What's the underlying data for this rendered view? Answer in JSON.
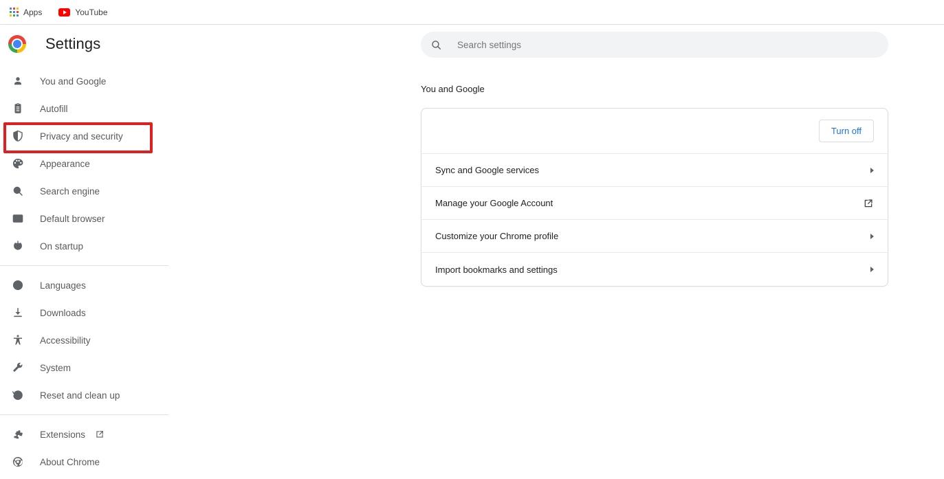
{
  "bookmarks_bar": {
    "items": [
      {
        "label": "Apps",
        "icon": "apps-grid-icon"
      },
      {
        "label": "YouTube",
        "icon": "youtube-icon"
      }
    ]
  },
  "sidebar": {
    "brand": {
      "logo_icon": "chrome-logo-icon",
      "title": "Settings"
    },
    "groups": [
      {
        "items": [
          {
            "label": "You and Google",
            "icon": "person-icon",
            "selected": false
          },
          {
            "label": "Autofill",
            "icon": "clipboard-icon",
            "selected": false
          },
          {
            "label": "Privacy and security",
            "icon": "shield-icon",
            "selected": true
          },
          {
            "label": "Appearance",
            "icon": "palette-icon",
            "selected": false
          },
          {
            "label": "Search engine",
            "icon": "magnifier-icon",
            "selected": false
          },
          {
            "label": "Default browser",
            "icon": "browser-window-icon",
            "selected": false
          },
          {
            "label": "On startup",
            "icon": "power-icon",
            "selected": false
          }
        ]
      },
      {
        "items": [
          {
            "label": "Languages",
            "icon": "globe-icon",
            "selected": false
          },
          {
            "label": "Downloads",
            "icon": "download-icon",
            "selected": false
          },
          {
            "label": "Accessibility",
            "icon": "accessibility-icon",
            "selected": false
          },
          {
            "label": "System",
            "icon": "wrench-icon",
            "selected": false
          },
          {
            "label": "Reset and clean up",
            "icon": "history-restore-icon",
            "selected": false
          }
        ]
      },
      {
        "items": [
          {
            "label": "Extensions",
            "icon": "puzzle-piece-icon",
            "selected": false,
            "trailing_icon": "external-link-icon"
          },
          {
            "label": "About Chrome",
            "icon": "chrome-outline-icon",
            "selected": false
          }
        ]
      }
    ],
    "highlight_color": "#e02020",
    "highlighted_item": "Privacy and security"
  },
  "main": {
    "search": {
      "placeholder": "Search settings",
      "value": "",
      "icon": "search-icon"
    },
    "section_heading": "You and Google",
    "card": {
      "profile_row": {
        "turn_off_label": "Turn off",
        "turn_off_color": "#1a73e8"
      },
      "rows": [
        {
          "label": "Sync and Google services",
          "trailing_icon": "chevron-right-icon"
        },
        {
          "label": "Manage your Google Account",
          "trailing_icon": "external-link-icon"
        },
        {
          "label": "Customize your Chrome profile",
          "trailing_icon": "chevron-right-icon"
        },
        {
          "label": "Import bookmarks and settings",
          "trailing_icon": "chevron-right-icon"
        }
      ]
    }
  },
  "colors": {
    "accent_blue": "#1a73e8",
    "icon_gray": "#5f6368",
    "text_primary": "#202124",
    "text_secondary": "#5a5a5a",
    "divider": "#e0e0e0",
    "search_bg": "#f1f3f4",
    "highlight_red": "#e02020"
  }
}
